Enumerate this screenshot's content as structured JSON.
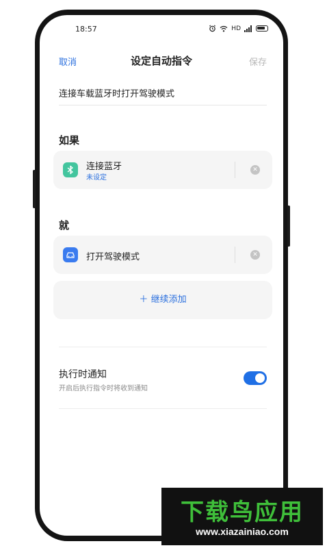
{
  "status_bar": {
    "time": "18:57",
    "network": "HD"
  },
  "nav": {
    "cancel": "取消",
    "title": "设定自动指令",
    "save": "保存"
  },
  "command_name": "连接车载蓝牙时打开驾驶模式",
  "if_section": {
    "heading": "如果",
    "condition": {
      "label": "连接蓝牙",
      "status": "未设定",
      "icon": "bluetooth-icon",
      "icon_color": "#43c59e"
    }
  },
  "then_section": {
    "heading": "就",
    "action": {
      "label": "打开驾驶模式",
      "icon": "car-icon",
      "icon_color": "#3a7bef"
    },
    "add_label": "继续添加"
  },
  "notification": {
    "title": "执行时通知",
    "subtitle": "开启后执行指令时将收到通知",
    "enabled": true
  },
  "watermark": {
    "brand": "下载鸟应用",
    "url": "www.xiazainiao.com"
  },
  "colors": {
    "accent": "#2a6fde",
    "toggle_on": "#1f6fe5",
    "watermark_green": "#3fbf3a"
  }
}
